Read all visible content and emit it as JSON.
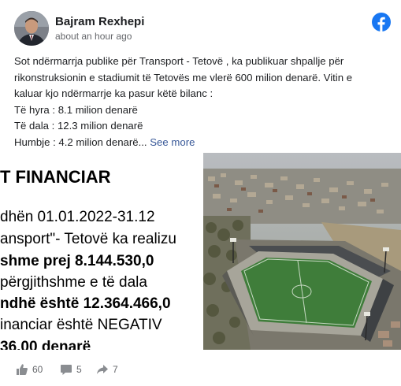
{
  "post": {
    "author": "Bajram Rexhepi",
    "time": "about an hour ago",
    "lines": [
      "Sot ndërmarrja publike për Transport - Tetovë , ka publikuar shpallje për",
      "rikonstruksionin e stadiumit të Tetovës me vlerë 600 milion denarë. Vitin e",
      "kaluar kjo ndërmarrje ka pasur këtë bilanc :",
      "Të hyra : 8.1 milion denarë",
      "Të dala : 12.3 milion denarë"
    ],
    "last_line": "Humbje : 4.2 milion denarë...",
    "see_more": "See more"
  },
  "document": {
    "heading": "T FINANCIAR",
    "rows": [
      "dhën   01.01.2022-31.12",
      "ansport\"- Tetovë ka realizu",
      "shme   prej   8.144.530,0",
      "përgjithshme e të dala",
      "ndhë është 12.364.466,0",
      "inanciar është NEGATIV",
      "36.00 denarë"
    ]
  },
  "stats": {
    "likes": "60",
    "comments": "5",
    "shares": "7"
  },
  "icons": {
    "brand": "facebook-icon",
    "like": "thumbs-up-icon",
    "comment": "comment-icon",
    "share": "share-icon"
  },
  "colors": {
    "facebook_blue": "#1877f2",
    "link": "#385898",
    "muted": "#65676b",
    "pitch": "#3f7d3a"
  }
}
